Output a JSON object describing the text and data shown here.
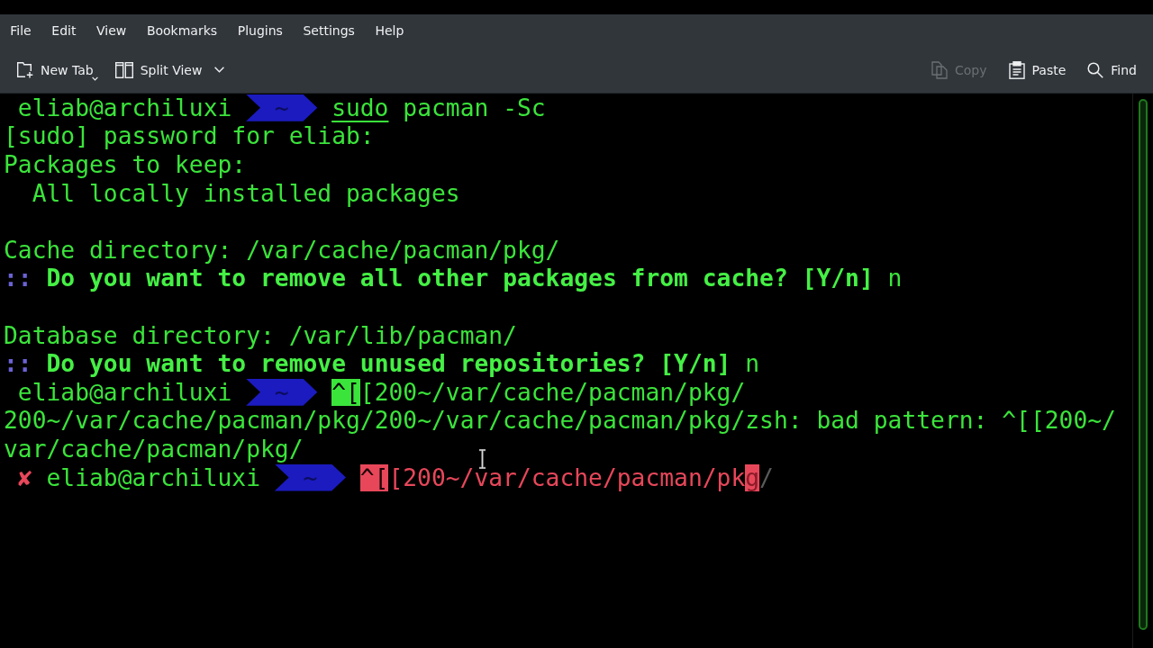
{
  "menu_bar": [
    "File",
    "Edit",
    "View",
    "Bookmarks",
    "Plugins",
    "Settings",
    "Help"
  ],
  "toolbar": {
    "left": [
      {
        "kind": "newtab",
        "label": "New Tab",
        "disabled": false,
        "delayed_menu": true,
        "dropdown": false
      },
      {
        "kind": "split",
        "label": "Split View",
        "disabled": false,
        "delayed_menu": false,
        "dropdown": true
      }
    ],
    "right": [
      {
        "kind": "copy",
        "label": "Copy",
        "disabled": true
      },
      {
        "kind": "paste",
        "label": "Paste",
        "disabled": false
      },
      {
        "kind": "find",
        "label": "Find",
        "disabled": false
      }
    ]
  },
  "terminal": {
    "lines": [
      {
        "kind": "prompt",
        "failed": false,
        "user": "eliab@archiluxi",
        "dir": "~",
        "command_valid": true,
        "segments": [
          {
            "kind": "underlined",
            "text": "sudo"
          },
          {
            "kind": "plain",
            "text": " pacman -Sc"
          }
        ]
      },
      {
        "kind": "output",
        "text": "[sudo] password for eliab:"
      },
      {
        "kind": "output",
        "text": "Packages to keep:"
      },
      {
        "kind": "indented",
        "text": "All locally installed packages"
      },
      {
        "kind": "blank"
      },
      {
        "kind": "output",
        "text": "Cache directory: /var/cache/pacman/pkg/"
      },
      {
        "kind": "question",
        "marker": "::",
        "text": "Do you want to remove all other packages from cache? [Y/n]",
        "answer": "n"
      },
      {
        "kind": "blank"
      },
      {
        "kind": "output",
        "text": "Database directory: /var/lib/pacman/"
      },
      {
        "kind": "question",
        "marker": "::",
        "text": "Do you want to remove unused repositories? [Y/n]",
        "answer": "n"
      },
      {
        "kind": "prompt",
        "failed": false,
        "user": "eliab@archiluxi",
        "dir": "~",
        "command_valid": true,
        "segments": [
          {
            "kind": "escape",
            "text": "^["
          },
          {
            "kind": "plain",
            "text": "[200~/var/cache/pacman/pkg/"
          }
        ]
      },
      {
        "kind": "output",
        "text": "200~/var/cache/pacman/pkg/200~/var/cache/pacman/pkg/zsh: bad pattern: ^[[200~/"
      },
      {
        "kind": "output",
        "text": "var/cache/pacman/pkg/"
      },
      {
        "kind": "prompt",
        "failed": true,
        "status_mark": "✘",
        "user": "eliab@archiluxi",
        "dir": "~",
        "command_valid": false,
        "segments": [
          {
            "kind": "escape",
            "text": "^["
          },
          {
            "kind": "plain",
            "text": "[200~/var/cache/pacman/pk"
          },
          {
            "kind": "cursor",
            "text": "g"
          },
          {
            "kind": "suggestion",
            "text": "/"
          }
        ]
      }
    ]
  }
}
